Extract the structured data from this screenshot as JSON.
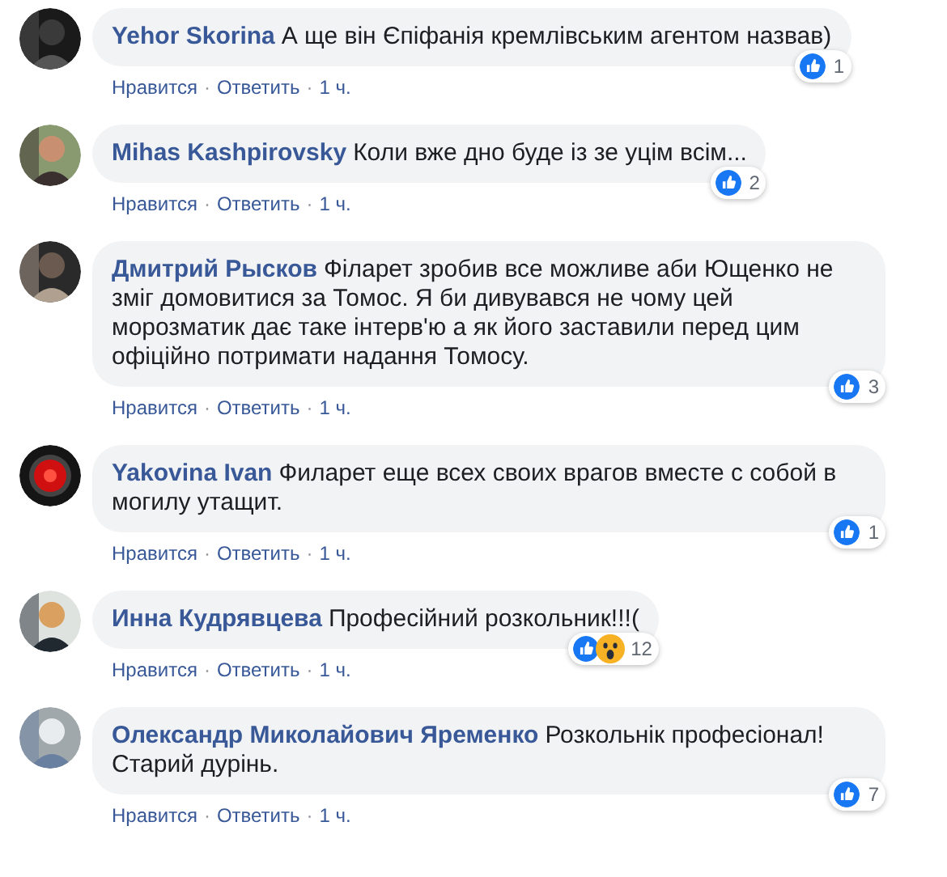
{
  "comments": [
    {
      "author": "Yehor Skorina",
      "text": "А ще він Єпіфанія кремлівським агентом назвав)",
      "reactions": [
        {
          "kind": "like"
        }
      ],
      "reaction_count": "1",
      "actions": [
        "Нравится",
        "Ответить"
      ],
      "separator": "·",
      "time": "1 ч."
    },
    {
      "author": "Mihas Kashpirovsky",
      "text": "Коли вже дно буде із зе уцім всім...",
      "reactions": [
        {
          "kind": "like"
        }
      ],
      "reaction_count": "2",
      "actions": [
        "Нравится",
        "Ответить"
      ],
      "separator": "·",
      "time": "1 ч."
    },
    {
      "author": "Дмитрий Рысков",
      "text": "Філарет зробив все можливе аби Ющенко не зміг домовитися за Томос. Я би дивувався не чому цей морозматик дає таке інтерв'ю а як його заставили перед цим офіційно потримати надання Томосу.",
      "reactions": [
        {
          "kind": "like"
        }
      ],
      "reaction_count": "3",
      "actions": [
        "Нравится",
        "Ответить"
      ],
      "separator": "·",
      "time": "1 ч."
    },
    {
      "author": "Yakovina Ivan",
      "text": "Филарет еще всех своих врагов вместе с собой в могилу утащит.",
      "reactions": [
        {
          "kind": "like"
        }
      ],
      "reaction_count": "1",
      "actions": [
        "Нравится",
        "Ответить"
      ],
      "separator": "·",
      "time": "1 ч."
    },
    {
      "author": "Инна Кудрявцева",
      "text": "Професійний розкольник!!!(",
      "reactions": [
        {
          "kind": "like"
        },
        {
          "kind": "wow"
        }
      ],
      "reaction_count": "12",
      "actions": [
        "Нравится",
        "Ответить"
      ],
      "separator": "·",
      "time": "1 ч."
    },
    {
      "author": "Олександр Миколайович Яременко",
      "text": "Розкольнік професіонал! Старий дурінь.",
      "reactions": [
        {
          "kind": "like"
        }
      ],
      "reaction_count": "7",
      "actions": [
        "Нравится",
        "Ответить"
      ],
      "separator": "·",
      "time": "1 ч."
    }
  ]
}
